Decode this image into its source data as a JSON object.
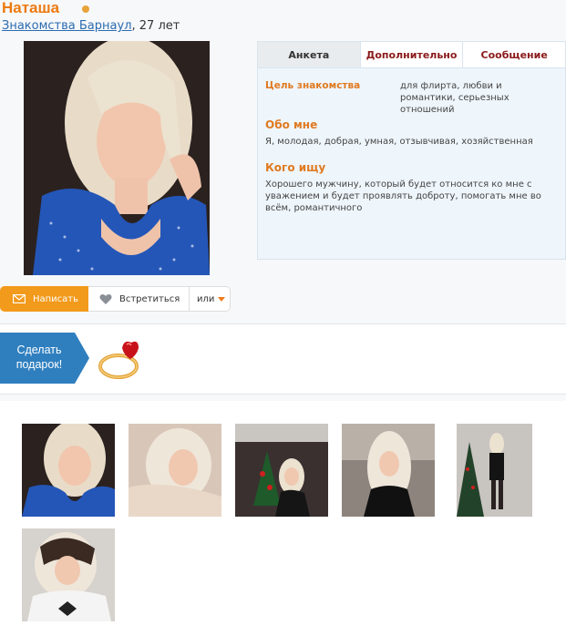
{
  "profile": {
    "name": "Наташа",
    "city_link": "Знакомства Барнаул",
    "age": ", 27 лет"
  },
  "tabs": [
    "Анкета",
    "Дополнительно",
    "Сообщение"
  ],
  "anketa": {
    "goal_label": "Цель знакомства",
    "goal_value": "для флирта, любви и романтики, серьезных отношений",
    "about_title": "Обо мне",
    "about_text": "Я, молодая, добрая, умная, отзывчивая, хозяйственная",
    "seeking_title": "Кого ищу",
    "seeking_text": "Хорошего мужчину, который будет относится ко мне с уважением и будет проявлять доброту, помогать мне во всём, романтичного"
  },
  "actions": {
    "write": "Написать",
    "meet": "Встретиться",
    "or": "или"
  },
  "gift": {
    "button_text": "Сделать подарок!"
  },
  "colors": {
    "accent_orange": "#f29a1b",
    "name_orange": "#ec7a0f",
    "gift_blue": "#2f7fbf",
    "link_blue": "#2b6cb0"
  },
  "icons": [
    "envelope-icon",
    "heart-icon",
    "caret-down-icon",
    "ring-icon"
  ]
}
